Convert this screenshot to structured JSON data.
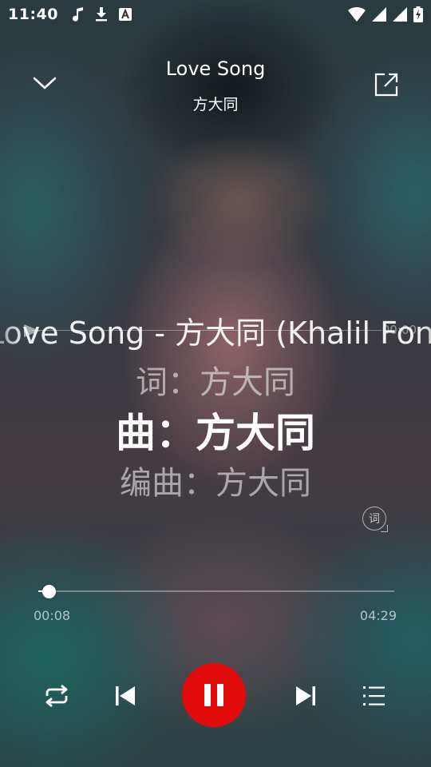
{
  "status_bar": {
    "time": "11:40",
    "left_icons": [
      "music-note-icon",
      "download-icon",
      "font-a-icon"
    ],
    "right_icons": [
      "wifi-icon",
      "signal-icon",
      "signal-icon",
      "battery-charging-icon"
    ]
  },
  "header": {
    "title": "Love Song",
    "artist": "方大同"
  },
  "lyrics": {
    "scroll_line": "Love Song - 方大同 (Khalil Fong)",
    "seek_time": "00:00",
    "previous": "词：方大同",
    "current": "曲：方大同",
    "next": "编曲：方大同",
    "toggle_label": "词"
  },
  "player": {
    "elapsed": "00:08",
    "total": "04:29",
    "progress": 0.03
  },
  "colors": {
    "play_button": "#e00a0a",
    "text": "#ffffff"
  }
}
